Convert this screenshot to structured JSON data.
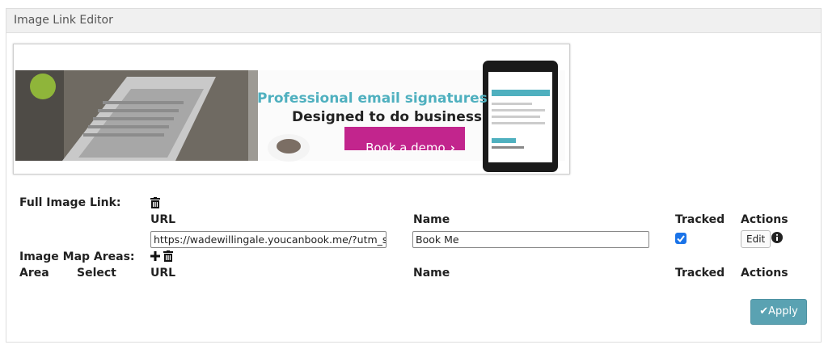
{
  "panel": {
    "title": "Image Link Editor"
  },
  "banner": {
    "headline": "Professional email signatures",
    "subhead": "Designed to do business",
    "cta": "Book a demo",
    "colors": {
      "headline": "#4fb0bf",
      "subhead": "#222222",
      "cta": "#c2258d"
    }
  },
  "full_image_link": {
    "label": "Full Image Link:",
    "columns": {
      "url": "URL",
      "name": "Name",
      "tracked": "Tracked",
      "actions": "Actions"
    },
    "row": {
      "url": "https://wadewillingale.youcanbook.me/?utm_source",
      "name": "Book Me",
      "tracked": true,
      "edit_label": "Edit"
    }
  },
  "image_map_areas": {
    "label": "Image Map Areas:",
    "columns": {
      "area": "Area",
      "select": "Select",
      "url": "URL",
      "name": "Name",
      "tracked": "Tracked",
      "actions": "Actions"
    }
  },
  "apply_button": {
    "label": "Apply",
    "color": "#5aa2b2"
  }
}
